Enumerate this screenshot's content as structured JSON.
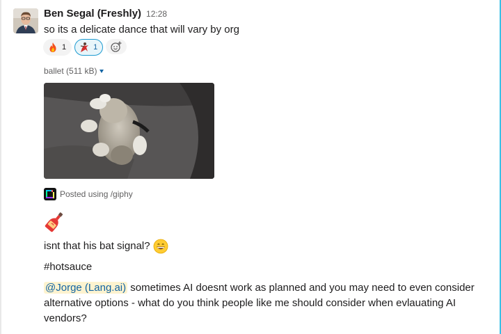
{
  "message": {
    "author": "Ben Segal (Freshly)",
    "time": "12:28",
    "text1": "so its a delicate dance that will vary by org",
    "reactions": [
      {
        "emoji": "fire-emoji",
        "count": "1",
        "reacted": false
      },
      {
        "emoji": "dancer-emoji",
        "count": "1",
        "reacted": true
      }
    ],
    "add_reaction_icon": "add-emoji-icon",
    "attachment": {
      "label": "ballet (511 kB)",
      "posted_via": "Posted using /giphy"
    },
    "text2": "isnt that his bat signal?",
    "text3": "#hotsauce",
    "mention": "@Jorge (Lang.ai)",
    "text4": " sometimes AI doesnt work as planned and you may need to even consider alternative options - what do you think people like me should consider when evlauating AI vendors?"
  },
  "colors": {
    "link": "#1264a3",
    "mention_bg": "#fdf3cf",
    "reaction_active_border": "#1d9bd1"
  }
}
